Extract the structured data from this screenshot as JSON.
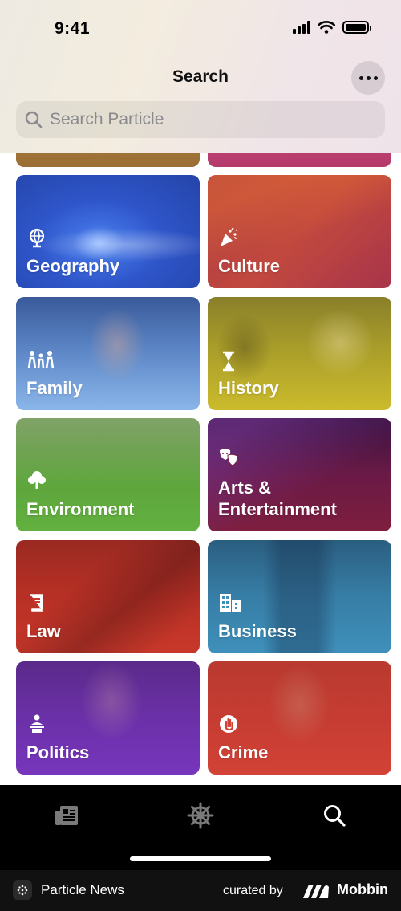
{
  "status_bar": {
    "time": "9:41"
  },
  "header": {
    "title": "Search",
    "search_placeholder": "Search Particle"
  },
  "categories": [
    {
      "label": "Geography",
      "icon": "globe-icon",
      "color": "#3a64d8"
    },
    {
      "label": "Culture",
      "icon": "party-popper-icon",
      "color": "#b23a48"
    },
    {
      "label": "Family",
      "icon": "family-icon",
      "color": "#6d9fd6"
    },
    {
      "label": "History",
      "icon": "hourglass-icon",
      "color": "#c5b42a"
    },
    {
      "label": "Environment",
      "icon": "tree-icon",
      "color": "#58a63a"
    },
    {
      "label": "Arts &\nEntertainment",
      "icon": "theater-masks-icon",
      "color": "#7a1f3f"
    },
    {
      "label": "Law",
      "icon": "book-icon",
      "color": "#c53528"
    },
    {
      "label": "Business",
      "icon": "building-icon",
      "color": "#3d8db5"
    },
    {
      "label": "Politics",
      "icon": "podium-icon",
      "color": "#7332b8"
    },
    {
      "label": "Crime",
      "icon": "hand-stop-icon",
      "color": "#cc3a32"
    }
  ],
  "tab_bar": {
    "tabs": [
      {
        "name": "news-feed",
        "icon": "newspaper-icon"
      },
      {
        "name": "explore",
        "icon": "ship-wheel-icon"
      },
      {
        "name": "search",
        "icon": "search-icon"
      }
    ]
  },
  "footer": {
    "app_name": "Particle News",
    "curated_by": "curated by",
    "brand": "Mobbin"
  }
}
